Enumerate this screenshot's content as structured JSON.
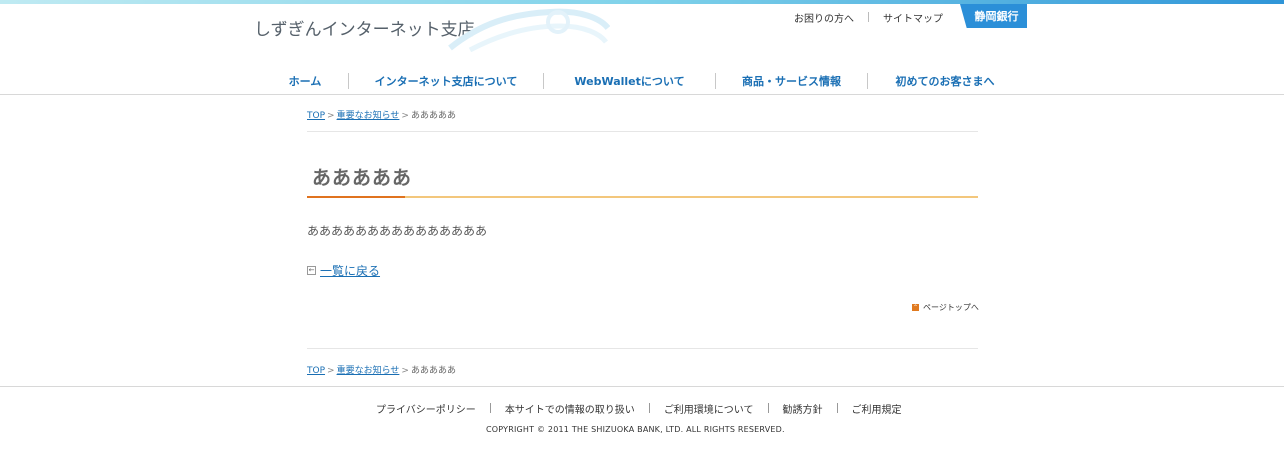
{
  "header": {
    "site_name": "しずぎんインターネット支店",
    "top_links": [
      "お困りの方へ",
      "サイトマップ"
    ],
    "bank_button": "静岡銀行"
  },
  "global_nav": [
    {
      "label": "ホーム"
    },
    {
      "label": "インターネット支店について"
    },
    {
      "label": "WebWalletについて"
    },
    {
      "label": "商品・サービス情報"
    },
    {
      "label": "初めてのお客さまへ"
    }
  ],
  "breadcrumb": {
    "top": "TOP",
    "parent": "重要なお知らせ",
    "current": "あああああ",
    "separator": ">"
  },
  "article": {
    "title": "あああああ",
    "body": "あああああああああああああああ",
    "back_link": "一覧に戻る"
  },
  "page_top": "ページトップへ",
  "footer": {
    "links": [
      "プライバシーポリシー",
      "本サイトでの情報の取り扱い",
      "ご利用環境について",
      "勧誘方針",
      "ご利用規定"
    ],
    "copyright": "COPYRIGHT © 2011 THE SHIZUOKA BANK, LTD. ALL RIGHTS RESERVED."
  },
  "colors": {
    "accent_blue": "#2b8fd8",
    "link_blue": "#1a6fb4",
    "title_orange": "#e0731f",
    "title_line": "#f3c77c"
  }
}
